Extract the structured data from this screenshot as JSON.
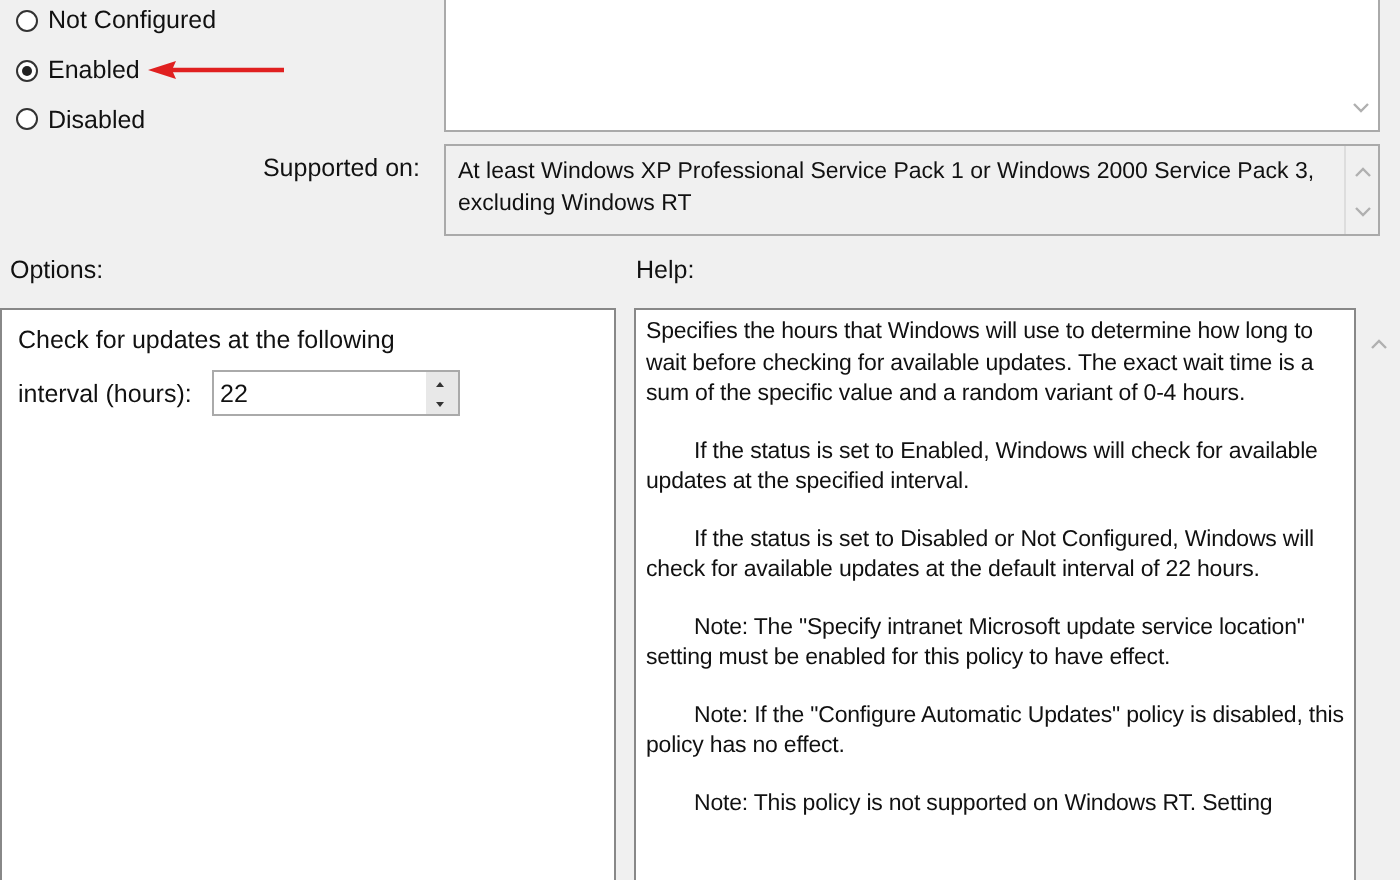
{
  "state_options": [
    {
      "label": "Not Configured",
      "selected": false
    },
    {
      "label": "Enabled",
      "selected": true
    },
    {
      "label": "Disabled",
      "selected": false
    }
  ],
  "supported_on": {
    "label": "Supported on:",
    "value": "At least Windows XP Professional Service Pack 1 or Windows 2000 Service Pack 3, excluding Windows RT"
  },
  "options": {
    "label": "Options:",
    "prompt": "Check for updates at the following",
    "field_label": "interval (hours):",
    "value": "22"
  },
  "help": {
    "label": "Help:",
    "paragraphs": [
      "Specifies the hours that Windows will use to determine how long to wait before checking for available updates. The exact wait time is a sum of the specific value and a random variant of 0-4 hours.",
      "If the status is set to Enabled, Windows will check for available updates at the specified interval.",
      "If the status is set to Disabled or Not Configured, Windows will check for available updates at the default interval of 22 hours.",
      "Note: The \"Specify intranet Microsoft update service location\" setting must be enabled for this policy to have effect.",
      "Note: If the \"Configure Automatic Updates\" policy is disabled, this policy has no effect.",
      "Note: This policy is not supported on Windows RT. Setting"
    ]
  }
}
